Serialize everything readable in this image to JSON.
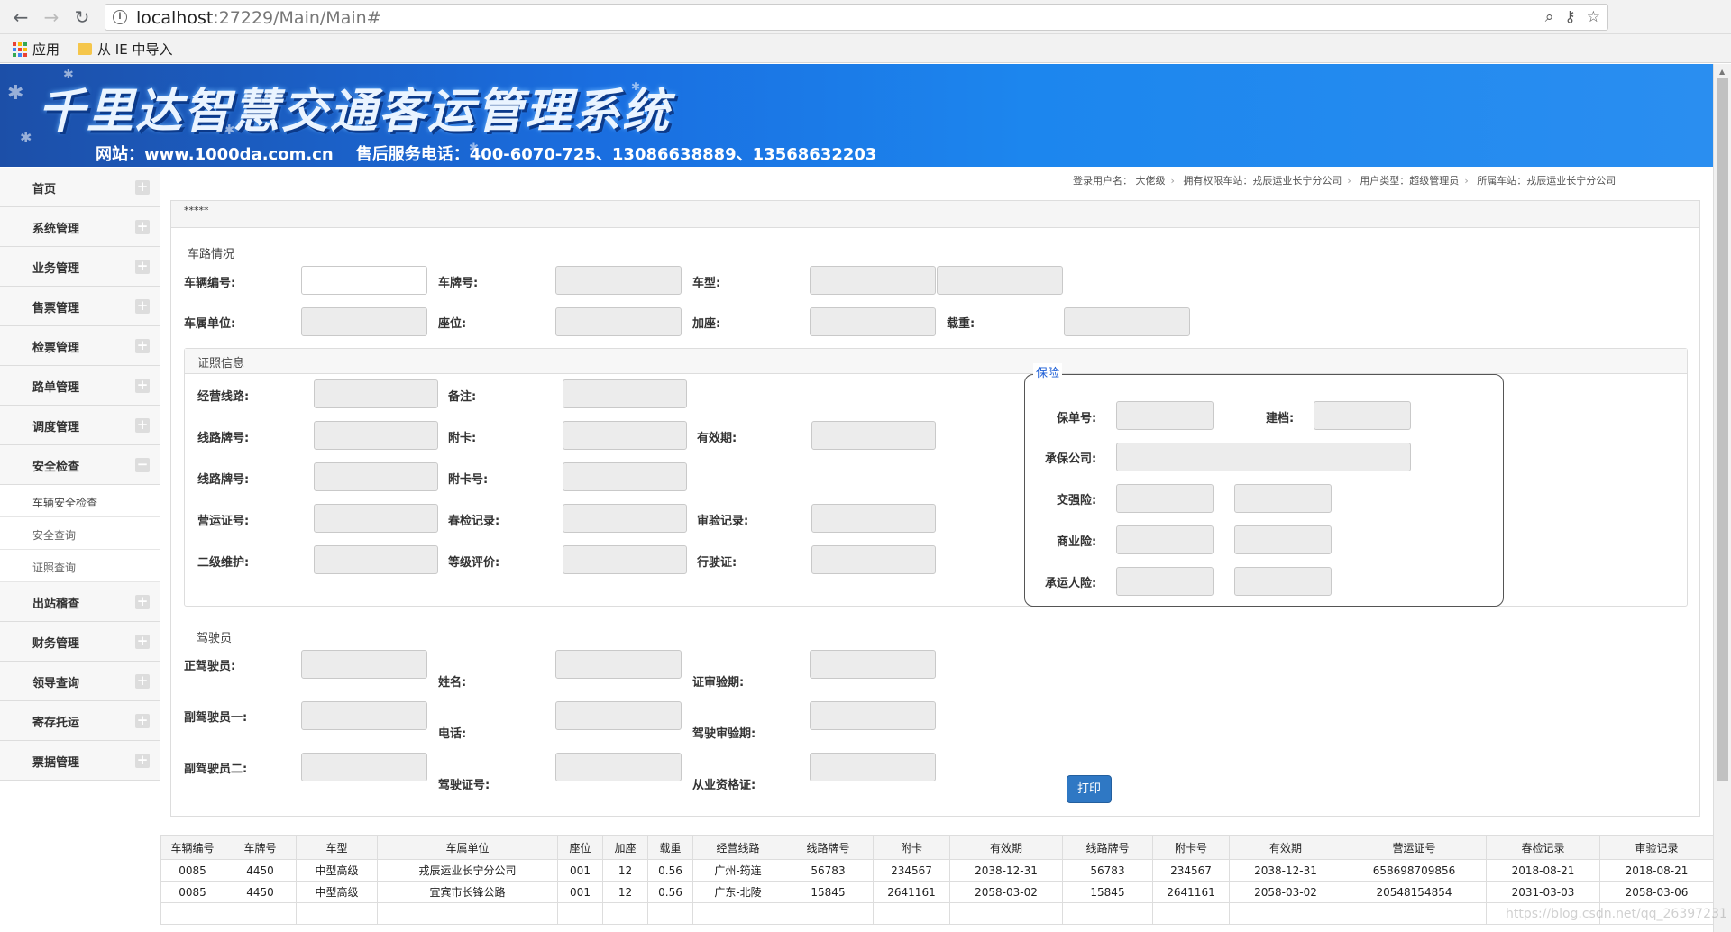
{
  "browser": {
    "url_host": "localhost",
    "url_path": ":27229/Main/Main#",
    "bookmarks": [
      "应用",
      "从 IE 中导入"
    ]
  },
  "banner": {
    "title": "千里达智慧交通客运管理系统",
    "subtitle": "网站：www.1000da.com.cn    售后服务电话：400-6070-725、13086638889、13568632203"
  },
  "sidebar": {
    "items": [
      {
        "label": "首页",
        "toggle": "+"
      },
      {
        "label": "系统管理",
        "toggle": "+"
      },
      {
        "label": "业务管理",
        "toggle": "+"
      },
      {
        "label": "售票管理",
        "toggle": "+"
      },
      {
        "label": "检票管理",
        "toggle": "+"
      },
      {
        "label": "路单管理",
        "toggle": "+"
      },
      {
        "label": "调度管理",
        "toggle": "+"
      },
      {
        "label": "安全检查",
        "toggle": "−"
      }
    ],
    "subitems": [
      "车辆安全检查",
      "安全查询",
      "证照查询"
    ],
    "items_after": [
      {
        "label": "出站稽查",
        "toggle": "+"
      },
      {
        "label": "财务管理",
        "toggle": "+"
      },
      {
        "label": "领导查询",
        "toggle": "+"
      },
      {
        "label": "寄存托运",
        "toggle": "+"
      },
      {
        "label": "票据管理",
        "toggle": "+"
      }
    ]
  },
  "user_info": {
    "user": "登录用户名： 大佬级",
    "station_rights": "拥有权限车站：戎辰运业长宁分公司",
    "user_type": "用户类型：超级管理员",
    "station": "所属车站：戎辰运业长宁分公司"
  },
  "panel": {
    "header": "*****",
    "vehicle_section": "车路情况",
    "vehicle_labels": {
      "vehicle_no": "车辆编号:",
      "plate": "车牌号:",
      "model": "车型:",
      "owner": "车属单位:",
      "seats": "座位:",
      "extra_seats": "加座:",
      "load": "载重:"
    },
    "cert_section": "证照信息",
    "cert_labels": {
      "route": "经营线路:",
      "remark": "备注:",
      "route_plate1": "线路牌号:",
      "card": "附卡:",
      "valid": "有效期:",
      "route_plate2": "线路牌号:",
      "card_no": "附卡号:",
      "license": "营运证号:",
      "spring_check": "春检记录:",
      "audit": "审验记录:",
      "maintenance": "二级维护:",
      "rating": "等级评价:",
      "driving_license": "行驶证:"
    },
    "insurance_legend": "保险",
    "insurance_labels": {
      "policy": "保单号:",
      "filed": "建档:",
      "insurer": "承保公司:",
      "compulsory": "交强险:",
      "commercial": "商业险:",
      "carrier": "承运人险:"
    },
    "driver_section": "驾驶员",
    "driver_labels": {
      "main": "正驾驶员:",
      "name": "姓名:",
      "cert_audit": "证审验期:",
      "assist1": "副驾驶员一:",
      "phone": "电话:",
      "drive_audit": "驾驶审验期:",
      "assist2": "副驾驶员二:",
      "license_no": "驾驶证号:",
      "qualification": "从业资格证:"
    },
    "print_label": "打印"
  },
  "table": {
    "headers": [
      "车辆编号",
      "车牌号",
      "车型",
      "车属单位",
      "座位",
      "加座",
      "载重",
      "经营线路",
      "线路牌号",
      "附卡",
      "有效期",
      "线路牌号",
      "附卡号",
      "有效期",
      "营运证号",
      "春检记录",
      "审验记录"
    ],
    "rows": [
      [
        "0085",
        "4450",
        "中型高级",
        "戎辰运业长宁分公司",
        "001",
        "12",
        "0.56",
        "广州-筠连",
        "56783",
        "234567",
        "2038-12-31",
        "56783",
        "234567",
        "2038-12-31",
        "658698709856",
        "2018-08-21",
        "2018-08-21"
      ],
      [
        "0085",
        "4450",
        "中型高级",
        "宜宾市长锋公路",
        "001",
        "12",
        "0.56",
        "广东-北陵",
        "15845",
        "2641161",
        "2058-03-02",
        "15845",
        "2641161",
        "2058-03-02",
        "20548154854",
        "2031-03-03",
        "2058-03-06"
      ]
    ]
  },
  "watermark": "https://blog.csdn.net/qq_26397231"
}
